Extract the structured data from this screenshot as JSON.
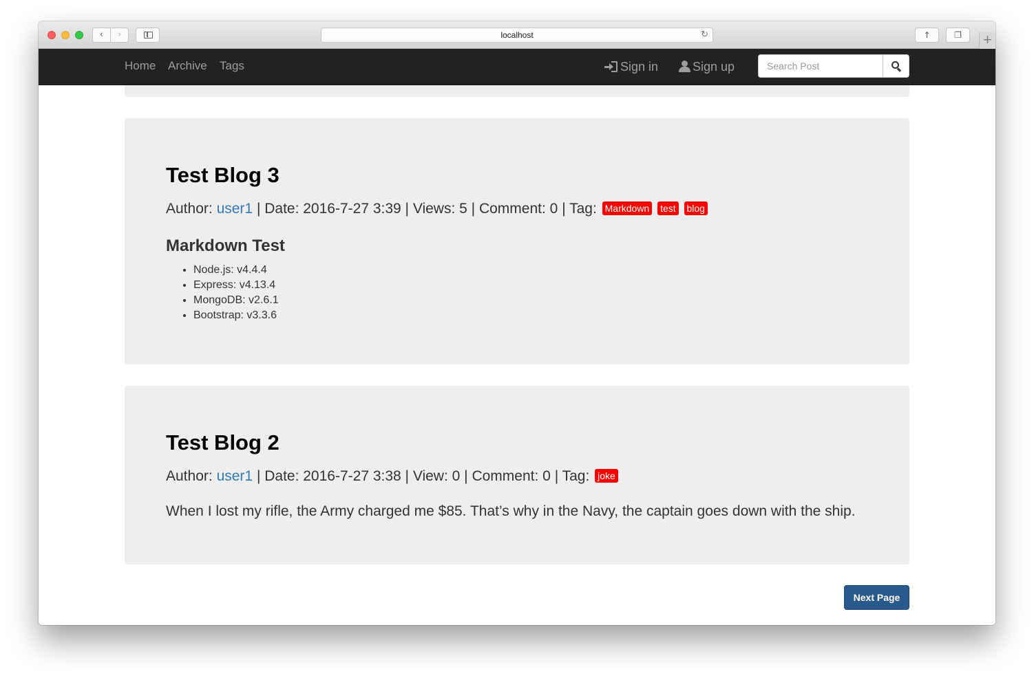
{
  "browser": {
    "url": "localhost",
    "icons": {
      "back": "chevron-left-icon",
      "forward": "chevron-right-icon",
      "sidebar": "sidebar-icon",
      "reload": "reload-icon",
      "share": "share-icon",
      "tabs": "tabs-overview-icon",
      "new_tab": "plus-icon"
    }
  },
  "navbar": {
    "links": [
      "Home",
      "Archive",
      "Tags"
    ],
    "sign_in": "Sign in",
    "sign_up": "Sign up",
    "search_placeholder": "Search Post",
    "search_value": ""
  },
  "posts": [
    {
      "title": "Test Blog 3",
      "author_label": "Author:",
      "author": "user1",
      "date": "| Date: 2016-7-27 3:39",
      "views": "| Views: 5",
      "comments": "| Comment: 0",
      "tag_label": "| Tag:",
      "tags": [
        "Markdown",
        "test",
        "blog"
      ],
      "body_heading": "Markdown Test",
      "body_list": [
        "Node.js: v4.4.4",
        "Express: v4.13.4",
        "MongoDB: v2.6.1",
        "Bootstrap: v3.3.6"
      ]
    },
    {
      "title": "Test Blog 2",
      "author_label": "Author:",
      "author": "user1",
      "date": "| Date: 2016-7-27 3:38",
      "views": "| View: 0",
      "comments": "| Comment: 0",
      "tag_label": "| Tag:",
      "tags": [
        "joke"
      ],
      "body_text": "When I lost my rifle, the Army charged me $85. That’s why in the Navy, the captain goes down with the ship."
    }
  ],
  "pagination": {
    "next_label": "Next Page"
  },
  "colors": {
    "navbar_bg": "#222222",
    "well_bg": "#eeeeee",
    "tag_bg": "#ff0000",
    "link": "#337ab7",
    "next_button": "#2a5a8c"
  }
}
